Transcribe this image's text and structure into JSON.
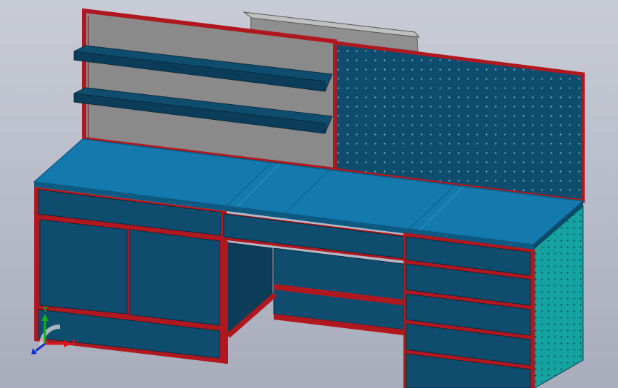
{
  "viewport": {
    "background_top": "#c9ccd6",
    "background_bottom": "#a9adbb"
  },
  "model": {
    "name": "",
    "colors": {
      "frame": "#b01820",
      "frame_dark": "#7a1015",
      "panel": "#0f4d6e",
      "panel_dark": "#0b3d58",
      "panel_light": "#135d85",
      "worktop": "#1479ad",
      "worktop_light": "#1a8cc6",
      "worktop_edge": "#0c5a82",
      "backboard_gray": "#8a8a8a",
      "side_pegboard": "#15a3a0",
      "pegboard_hole": "#7fb8d0",
      "lamp_gray": "#8f8f8f"
    }
  },
  "triad": {
    "x_label": "X",
    "y_label": "Y",
    "x_color": "#d8141c",
    "y_color": "#18b018",
    "z_color": "#1a2fd0"
  }
}
